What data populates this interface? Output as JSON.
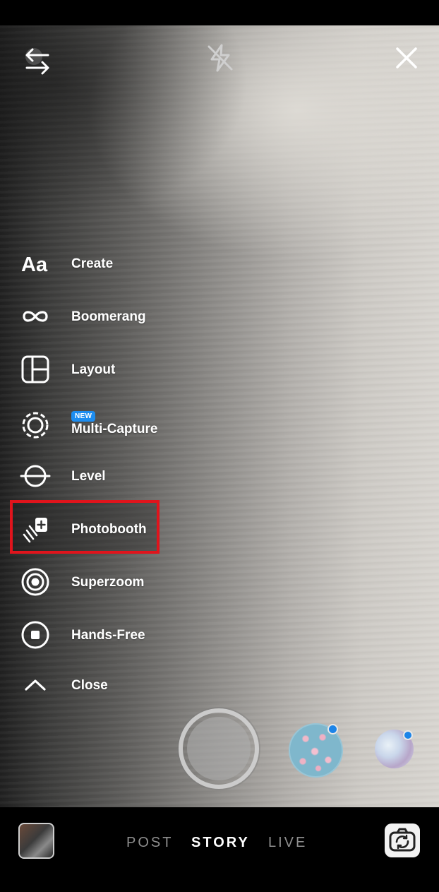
{
  "top_bar": {
    "switch_icon": "switch-arrows-icon",
    "flash_icon": "flash-off-icon",
    "close_icon": "close-icon"
  },
  "menu": {
    "items": [
      {
        "label": "Create",
        "icon": "text-aa-icon"
      },
      {
        "label": "Boomerang",
        "icon": "infinity-icon"
      },
      {
        "label": "Layout",
        "icon": "layout-grid-icon"
      },
      {
        "label": "Multi-Capture",
        "icon": "multi-capture-icon",
        "badge": "NEW"
      },
      {
        "label": "Level",
        "icon": "level-icon"
      },
      {
        "label": "Photobooth",
        "icon": "photobooth-icon",
        "highlighted": true
      },
      {
        "label": "Superzoom",
        "icon": "superzoom-icon"
      },
      {
        "label": "Hands-Free",
        "icon": "hands-free-icon"
      },
      {
        "label": "Close",
        "icon": "chevron-up-icon"
      }
    ]
  },
  "modes": {
    "post": "POST",
    "story": "STORY",
    "live": "LIVE",
    "selected": "STORY"
  },
  "colors": {
    "highlight_border": "#e0141c",
    "new_badge": "#1d8df0",
    "notification_dot": "#1c84e8"
  }
}
